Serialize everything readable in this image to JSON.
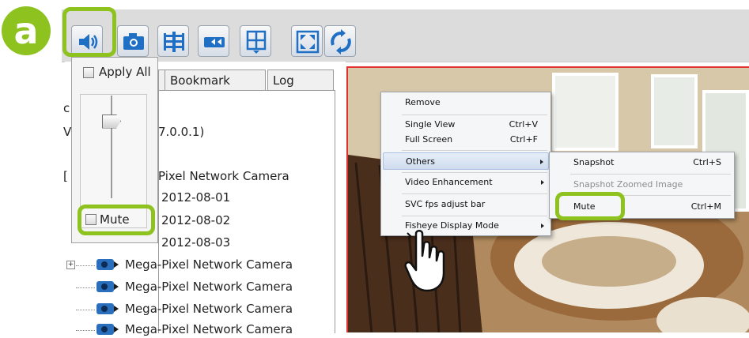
{
  "step_badge": "a",
  "toolbar": {
    "buttons": [
      {
        "icon": "volume-icon"
      },
      {
        "icon": "camera-icon"
      },
      {
        "icon": "settings-icon"
      },
      {
        "icon": "swap-icon"
      },
      {
        "icon": "layout-icon"
      },
      {
        "icon": "fullscreen-icon"
      },
      {
        "icon": "refresh-icon"
      }
    ]
  },
  "volume_popup": {
    "apply_all_label": "Apply All",
    "mute_label": "Mute",
    "level": 0.75
  },
  "tabs": [
    "Bookmark Search",
    "Log Viewer"
  ],
  "tree": {
    "partial_chars": [
      "c",
      "V",
      "(",
      "["
    ],
    "ip_text": "7.0.0.1)",
    "camera_partial": "Pixel Network Camera",
    "dates": [
      "2012-08-01",
      "2012-08-02",
      "2012-08-03"
    ],
    "cameras": [
      "Mega-Pixel Network Camera",
      "Mega-Pixel Network Camera",
      "Mega-Pixel Network Camera",
      "Mega-Pixel Network Camera"
    ]
  },
  "context_menu": {
    "items": [
      {
        "label": "Remove",
        "shortcut": ""
      },
      {
        "label": "Single View",
        "shortcut": "Ctrl+V"
      },
      {
        "label": "Full Screen",
        "shortcut": "Ctrl+F"
      },
      {
        "label": "Others",
        "shortcut": ""
      },
      {
        "label": "Video Enhancement",
        "shortcut": ""
      },
      {
        "label": "SVC fps adjust bar",
        "shortcut": ""
      },
      {
        "label": "Fisheye Display Mode",
        "shortcut": ""
      }
    ]
  },
  "submenu": {
    "items": [
      {
        "label": "Snapshot",
        "shortcut": "Ctrl+S"
      },
      {
        "label": "Snapshot Zoomed Image",
        "shortcut": ""
      },
      {
        "label": "Mute",
        "shortcut": "Ctrl+M"
      }
    ]
  },
  "colors": {
    "highlight": "#8dc21f",
    "video_border": "#e03030",
    "toolbar_icon": "#1f6fc4"
  }
}
